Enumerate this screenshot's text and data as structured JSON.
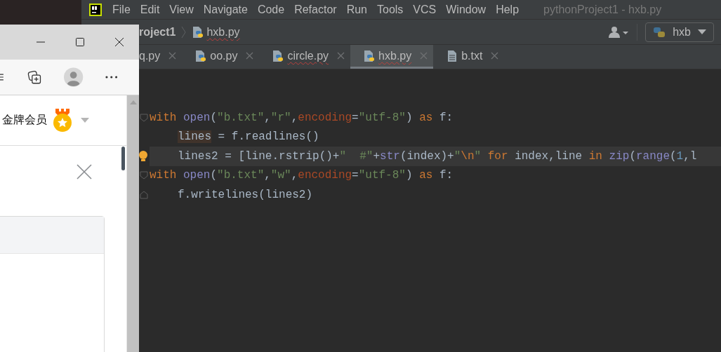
{
  "ide": {
    "menu": [
      {
        "label": "File"
      },
      {
        "label": "Edit"
      },
      {
        "label": "View"
      },
      {
        "label": "Navigate"
      },
      {
        "label": "Code"
      },
      {
        "label": "Refactor"
      },
      {
        "label": "Run"
      },
      {
        "label": "Tools"
      },
      {
        "label": "VCS"
      },
      {
        "label": "Window"
      },
      {
        "label": "Help"
      }
    ],
    "title": "pythonProject1 - hxb.py",
    "breadcrumb": {
      "project": "roject1",
      "file": "hxb.py",
      "file_error": true
    },
    "run_config": "hxb",
    "tabs": [
      {
        "label": "q.py",
        "selected": false,
        "error": false
      },
      {
        "label": "oo.py",
        "kind": "python",
        "selected": false,
        "error": false
      },
      {
        "label": "circle.py",
        "kind": "python",
        "selected": false,
        "error": true
      },
      {
        "label": "hxb.py",
        "kind": "python",
        "selected": true,
        "error": true
      },
      {
        "label": "b.txt",
        "kind": "text",
        "selected": false,
        "error": false
      }
    ],
    "code": [
      {
        "fold_start": true,
        "fold_end": false,
        "indented": false,
        "current": false,
        "bulb": false,
        "tokens": [
          {
            "kind": "kw",
            "t": "with "
          },
          {
            "kind": "builtin",
            "t": "open"
          },
          {
            "kind": "plain",
            "t": "("
          },
          {
            "kind": "str",
            "t": "\"b.txt\""
          },
          {
            "kind": "plain",
            "t": ","
          },
          {
            "kind": "str",
            "t": "\"r\""
          },
          {
            "kind": "plain",
            "t": ","
          },
          {
            "kind": "param",
            "t": "encoding"
          },
          {
            "kind": "plain",
            "t": "="
          },
          {
            "kind": "str",
            "t": "\"utf-8\""
          },
          {
            "kind": "plain",
            "t": ") "
          },
          {
            "kind": "kw",
            "t": "as "
          },
          {
            "kind": "plain",
            "t": "f:"
          }
        ]
      },
      {
        "fold_start": false,
        "fold_end": false,
        "indented": true,
        "current": false,
        "bulb": false,
        "tokens": [
          {
            "kind": "usage",
            "t": "lines"
          },
          {
            "kind": "plain",
            "t": " = f.readlines()"
          }
        ]
      },
      {
        "fold_start": false,
        "fold_end": false,
        "indented": true,
        "current": true,
        "bulb": true,
        "tokens": [
          {
            "kind": "plain",
            "t": "lines2 = [line.rstrip()+"
          },
          {
            "kind": "str",
            "t": "\"  #\""
          },
          {
            "kind": "plain",
            "t": "+"
          },
          {
            "kind": "builtin",
            "t": "str"
          },
          {
            "kind": "plain",
            "t": "(index)+"
          },
          {
            "kind": "str",
            "t": "\""
          },
          {
            "kind": "esc",
            "t": "\\n"
          },
          {
            "kind": "str",
            "t": "\""
          },
          {
            "kind": "kw",
            "t": " for "
          },
          {
            "kind": "plain",
            "t": "index,line "
          },
          {
            "kind": "kw",
            "t": "in "
          },
          {
            "kind": "builtin",
            "t": "zip"
          },
          {
            "kind": "plain",
            "t": "("
          },
          {
            "kind": "builtin",
            "t": "range"
          },
          {
            "kind": "plain",
            "t": "("
          },
          {
            "kind": "num",
            "t": "1"
          },
          {
            "kind": "plain",
            "t": ",l"
          }
        ]
      },
      {
        "fold_start": true,
        "fold_end": false,
        "indented": false,
        "current": false,
        "bulb": false,
        "tokens": [
          {
            "kind": "kw",
            "t": "with "
          },
          {
            "kind": "builtin",
            "t": "open"
          },
          {
            "kind": "plain",
            "t": "("
          },
          {
            "kind": "str",
            "t": "\"b.txt\""
          },
          {
            "kind": "plain",
            "t": ","
          },
          {
            "kind": "str",
            "t": "\"w\""
          },
          {
            "kind": "plain",
            "t": ","
          },
          {
            "kind": "param",
            "t": "encoding"
          },
          {
            "kind": "plain",
            "t": "="
          },
          {
            "kind": "str",
            "t": "\"utf-8\""
          },
          {
            "kind": "plain",
            "t": ") "
          },
          {
            "kind": "kw",
            "t": "as "
          },
          {
            "kind": "plain",
            "t": "f:"
          }
        ]
      },
      {
        "fold_start": false,
        "fold_end": true,
        "indented": true,
        "current": false,
        "bulb": false,
        "tokens": [
          {
            "kind": "plain",
            "t": "f.writelines(lines2)"
          }
        ]
      }
    ]
  },
  "browser": {
    "member_label": "金牌会员"
  }
}
